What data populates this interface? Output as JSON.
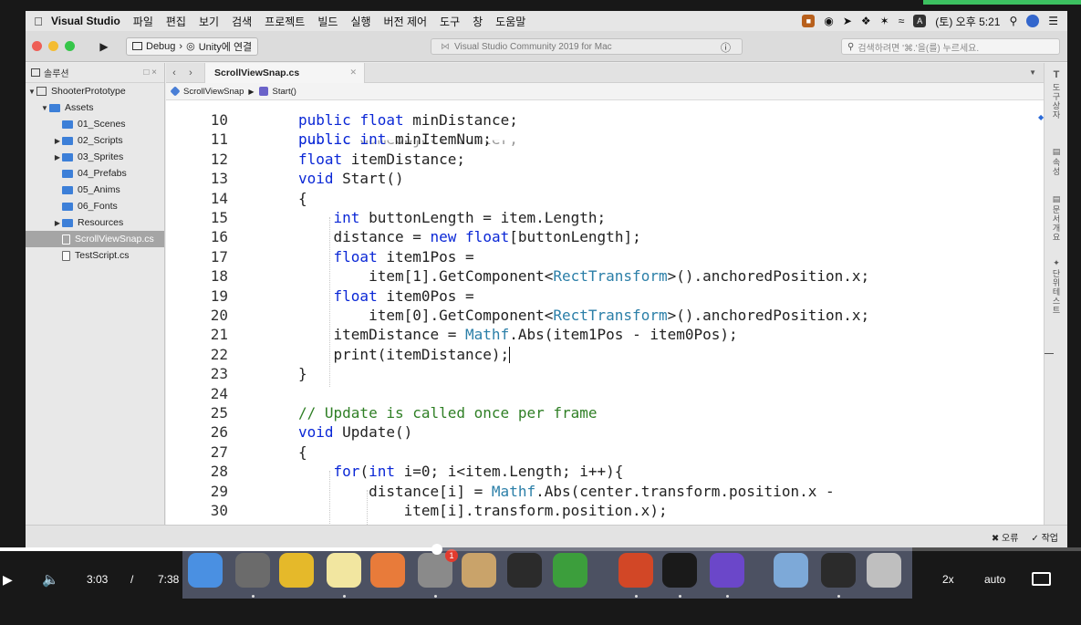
{
  "menubar": {
    "app_name": "Visual Studio",
    "items": [
      "파일",
      "편집",
      "보기",
      "검색",
      "프로젝트",
      "빌드",
      "실행",
      "버전 제어",
      "도구",
      "창",
      "도움말"
    ],
    "input_badge": "A",
    "clock": "(토) 오후 5:21"
  },
  "toolbar": {
    "config_label": "Debug",
    "target_label": "Unity에 연결",
    "status_text": "Visual Studio Community 2019 for Mac",
    "search_placeholder": "검색하려면 '⌘.'을(를) 누르세요."
  },
  "sidebar": {
    "title": "솔루션",
    "tree": [
      {
        "label": "ShooterPrototype",
        "kind": "solution",
        "depth": 0,
        "twisty": "▼",
        "selected": false
      },
      {
        "label": "Assets",
        "kind": "folder",
        "depth": 1,
        "twisty": "▼",
        "selected": false
      },
      {
        "label": "01_Scenes",
        "kind": "folder",
        "depth": 2,
        "twisty": "",
        "selected": false
      },
      {
        "label": "02_Scripts",
        "kind": "folder",
        "depth": 2,
        "twisty": "▶",
        "selected": false
      },
      {
        "label": "03_Sprites",
        "kind": "folder",
        "depth": 2,
        "twisty": "▶",
        "selected": false
      },
      {
        "label": "04_Prefabs",
        "kind": "folder",
        "depth": 2,
        "twisty": "",
        "selected": false
      },
      {
        "label": "05_Anims",
        "kind": "folder",
        "depth": 2,
        "twisty": "",
        "selected": false
      },
      {
        "label": "06_Fonts",
        "kind": "folder",
        "depth": 2,
        "twisty": "",
        "selected": false
      },
      {
        "label": "Resources",
        "kind": "folder",
        "depth": 2,
        "twisty": "▶",
        "selected": false
      },
      {
        "label": "ScrollViewSnap.cs",
        "kind": "file",
        "depth": 2,
        "twisty": "",
        "selected": true
      },
      {
        "label": "TestScript.cs",
        "kind": "file",
        "depth": 2,
        "twisty": "",
        "selected": false
      }
    ]
  },
  "editor": {
    "tab_label": "ScrollViewSnap.cs",
    "breadcrumb_class": "ScrollViewSnap",
    "breadcrumb_method": "Start()",
    "lines": [
      {
        "n": "10",
        "tokens": [
          {
            "t": "public",
            "c": "kw"
          },
          {
            "t": " "
          },
          {
            "t": "float",
            "c": "kw"
          },
          {
            "t": " minDistance;"
          }
        ]
      },
      {
        "n": "11",
        "tokens": [
          {
            "t": "public",
            "c": "kw"
          },
          {
            "t": " "
          },
          {
            "t": "int",
            "c": "kw"
          },
          {
            "t": " minItemNum;"
          }
        ]
      },
      {
        "n": "12",
        "tokens": [
          {
            "t": "float",
            "c": "kw"
          },
          {
            "t": " itemDistance;"
          }
        ]
      },
      {
        "n": "13",
        "tokens": [
          {
            "t": "void",
            "c": "kw"
          },
          {
            "t": " Start()"
          }
        ]
      },
      {
        "n": "14",
        "tokens": [
          {
            "t": "{"
          }
        ]
      },
      {
        "n": "15",
        "tokens": [
          {
            "t": "    "
          },
          {
            "t": "int",
            "c": "kw"
          },
          {
            "t": " buttonLength = item.Length;"
          }
        ]
      },
      {
        "n": "16",
        "tokens": [
          {
            "t": "    distance = "
          },
          {
            "t": "new",
            "c": "kw"
          },
          {
            "t": " "
          },
          {
            "t": "float",
            "c": "kw"
          },
          {
            "t": "[buttonLength];"
          }
        ]
      },
      {
        "n": "17",
        "tokens": [
          {
            "t": "    "
          },
          {
            "t": "float",
            "c": "kw"
          },
          {
            "t": " item1Pos ="
          }
        ]
      },
      {
        "n": "18",
        "tokens": [
          {
            "t": "        item[1].GetComponent<"
          },
          {
            "t": "RectTransform",
            "c": "ty"
          },
          {
            "t": ">().anchoredPosition.x;"
          }
        ]
      },
      {
        "n": "19",
        "tokens": [
          {
            "t": "    "
          },
          {
            "t": "float",
            "c": "kw"
          },
          {
            "t": " item0Pos ="
          }
        ]
      },
      {
        "n": "20",
        "tokens": [
          {
            "t": "        item[0].GetComponent<"
          },
          {
            "t": "RectTransform",
            "c": "ty"
          },
          {
            "t": ">().anchoredPosition.x;"
          }
        ]
      },
      {
        "n": "21",
        "tokens": [
          {
            "t": "    itemDistance = "
          },
          {
            "t": "Mathf",
            "c": "ty"
          },
          {
            "t": ".Abs(item1Pos - item0Pos);"
          }
        ]
      },
      {
        "n": "22",
        "tokens": [
          {
            "t": "    print(itemDistance);"
          }
        ]
      },
      {
        "n": "23",
        "tokens": [
          {
            "t": "}"
          }
        ]
      },
      {
        "n": "24",
        "tokens": []
      },
      {
        "n": "25",
        "tokens": [
          {
            "t": "// Update is called once per frame",
            "c": "cm"
          }
        ]
      },
      {
        "n": "26",
        "tokens": [
          {
            "t": "void",
            "c": "kw"
          },
          {
            "t": " Update()"
          }
        ]
      },
      {
        "n": "27",
        "tokens": [
          {
            "t": "{"
          }
        ]
      },
      {
        "n": "28",
        "tokens": [
          {
            "t": "    "
          },
          {
            "t": "for",
            "c": "kw"
          },
          {
            "t": "("
          },
          {
            "t": "int",
            "c": "kw"
          },
          {
            "t": " i=0; i<item.Length; i++){"
          }
        ]
      },
      {
        "n": "29",
        "tokens": [
          {
            "t": "        distance[i] = "
          },
          {
            "t": "Mathf",
            "c": "ty"
          },
          {
            "t": ".Abs(center.transform.position.x -"
          }
        ]
      },
      {
        "n": "30",
        "tokens": [
          {
            "t": "            item[i].transform.position.x);"
          }
        ]
      }
    ]
  },
  "right_panel": {
    "tabs": [
      "도구 상자",
      "속성",
      "문서 개요",
      "단위 테스트"
    ]
  },
  "bottombar": {
    "errors_label": "오류",
    "tasks_label": "작업"
  },
  "dock": {
    "apps": [
      {
        "name": "finder-icon",
        "color": "#4a90e2"
      },
      {
        "name": "launchpad-icon",
        "color": "#6b6b6b"
      },
      {
        "name": "chrome-icon",
        "color": "#e5b92a"
      },
      {
        "name": "notes-icon",
        "color": "#f2e6a0"
      },
      {
        "name": "photos-icon",
        "color": "#e87b3a"
      },
      {
        "name": "system-preferences-icon",
        "color": "#8a8a8a"
      },
      {
        "name": "notebook-icon",
        "color": "#c9a36a"
      },
      {
        "name": "unity-icon",
        "color": "#2b2b2b"
      },
      {
        "name": "camtasia-icon",
        "color": "#3c9e3c"
      },
      {
        "name": "powerpoint-icon",
        "color": "#d24726"
      },
      {
        "name": "unity-hub-icon",
        "color": "#1a1a1a"
      },
      {
        "name": "visual-studio-icon",
        "color": "#6b47c9"
      },
      {
        "name": "downloads-folder-icon",
        "color": "#7da9d8"
      },
      {
        "name": "terminal-icon",
        "color": "#2b2b2b"
      },
      {
        "name": "trash-icon",
        "color": "#bfbfbf"
      }
    ],
    "badge": "1"
  },
  "player": {
    "current_time": "3:03",
    "separator": "/",
    "duration": "7:38",
    "progress": 0.404,
    "speed": "2x",
    "quality": "auto"
  }
}
